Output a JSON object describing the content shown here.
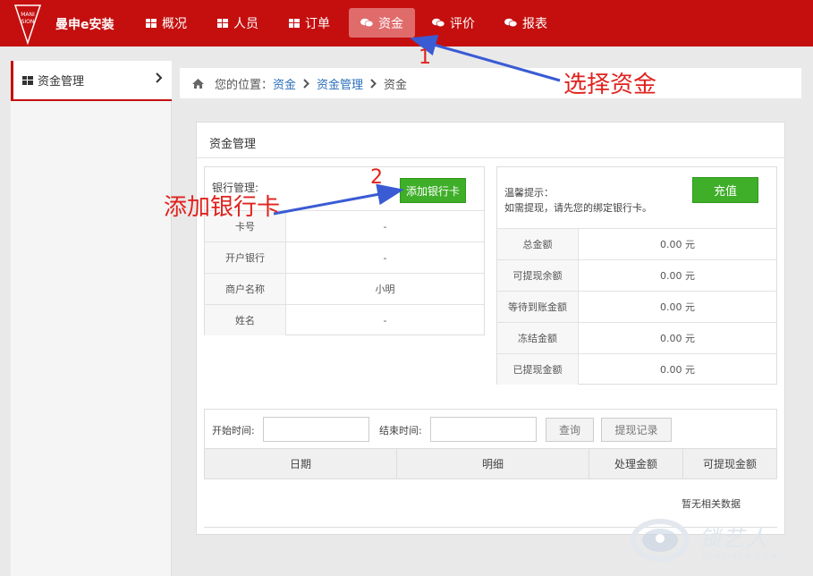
{
  "brand": "曼申e安装",
  "nav": [
    {
      "label": "概况",
      "icon": "grid-icon",
      "active": false
    },
    {
      "label": "人员",
      "icon": "grid-icon",
      "active": false
    },
    {
      "label": "订单",
      "icon": "grid-icon",
      "active": false
    },
    {
      "label": "资金",
      "icon": "chat-bubbles-icon",
      "active": true
    },
    {
      "label": "评价",
      "icon": "chat-bubbles-icon",
      "active": false
    },
    {
      "label": "报表",
      "icon": "chat-bubbles-icon",
      "active": false
    }
  ],
  "sidebar": {
    "label": "资金管理"
  },
  "breadcrumb": {
    "prefix": "您的位置：",
    "items": [
      "资金",
      "资金管理",
      "资金"
    ]
  },
  "card": {
    "title": "资金管理"
  },
  "bank": {
    "title": "银行管理:",
    "add_label": "添加银行卡",
    "rows": [
      {
        "label": "卡号",
        "value": "-"
      },
      {
        "label": "开户银行",
        "value": "-"
      },
      {
        "label": "商户名称",
        "value": "小明"
      },
      {
        "label": "姓名",
        "value": "-"
      }
    ]
  },
  "balance": {
    "tip_title": "温馨提示：",
    "tip_text": "如需提现，请先您的绑定银行卡。",
    "recharge_label": "充值",
    "rows": [
      {
        "label": "总金额",
        "value": "0.00 元"
      },
      {
        "label": "可提现余额",
        "value": "0.00 元"
      },
      {
        "label": "等待到账金额",
        "value": "0.00 元"
      },
      {
        "label": "冻结金额",
        "value": "0.00 元"
      },
      {
        "label": "已提现金额",
        "value": "0.00 元"
      }
    ]
  },
  "query": {
    "start_label": "开始时间:",
    "end_label": "结束时间:",
    "search_label": "查询",
    "history_label": "提现记录",
    "columns": [
      "日期",
      "明细",
      "处理金额",
      "可提现金额"
    ],
    "empty": "暂无相关数据"
  },
  "annotations": {
    "choose_funds": "选择资金",
    "add_card": "添加银行卡",
    "step1": "1",
    "step2": "2"
  },
  "logo_text": "MANISION",
  "watermark": {
    "main": "锁艺人",
    "sub": "SUOYIREN.COM"
  }
}
